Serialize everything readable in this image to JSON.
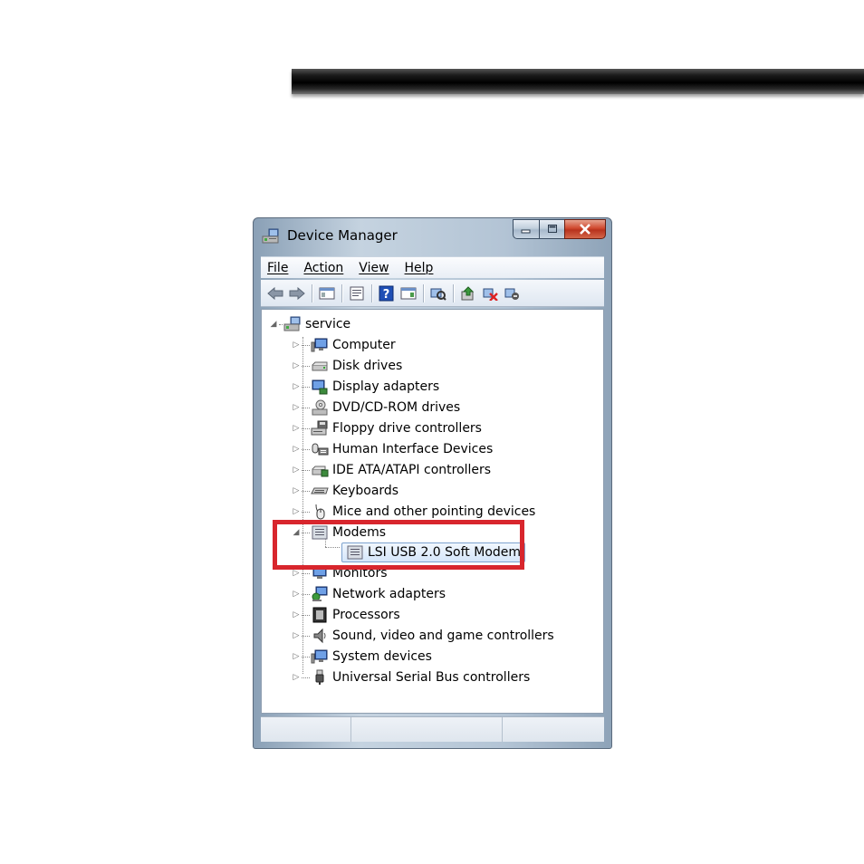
{
  "window": {
    "title": "Device Manager"
  },
  "menu": [
    {
      "label": "File"
    },
    {
      "label": "Action"
    },
    {
      "label": "View"
    },
    {
      "label": "Help"
    }
  ],
  "tree": {
    "root": "service",
    "categories": [
      "Computer",
      "Disk drives",
      "Display adapters",
      "DVD/CD-ROM drives",
      "Floppy drive controllers",
      "Human Interface Devices",
      "IDE ATA/ATAPI controllers",
      "Keyboards",
      "Mice and other pointing devices",
      "Modems",
      "Monitors",
      "Network adapters",
      "Processors",
      "Sound, video and game controllers",
      "System devices",
      "Universal Serial Bus controllers"
    ],
    "expanded": "Modems",
    "selected_child": "LSI USB 2.0 Soft Modem"
  },
  "colors": {
    "highlight": "#d8262d",
    "selection": "#d5e6fa"
  }
}
